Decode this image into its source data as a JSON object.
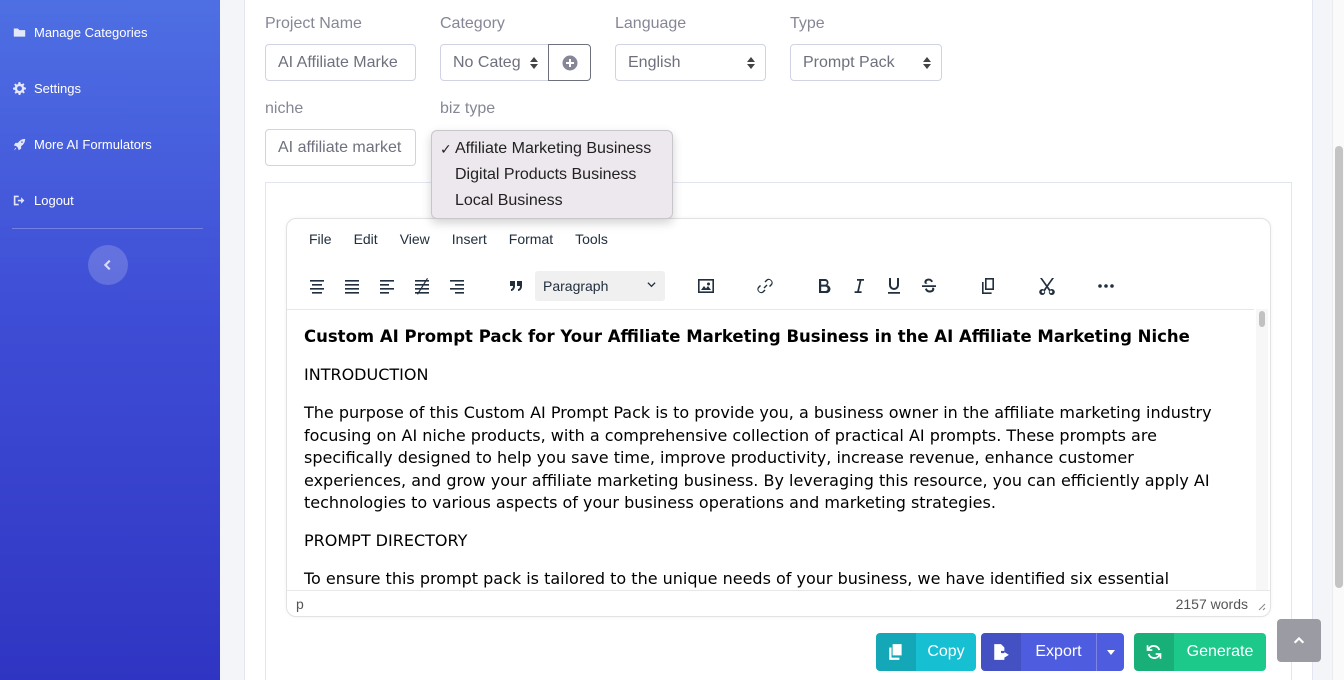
{
  "sidebar": {
    "items": [
      {
        "label": "Manage Categories",
        "icon": "folder-icon"
      },
      {
        "label": "Settings",
        "icon": "gear-icon"
      },
      {
        "label": "More AI Formulators",
        "icon": "rocket-icon"
      },
      {
        "label": "Logout",
        "icon": "sign-out-icon"
      }
    ],
    "collapse_icon": "chevron-left-icon"
  },
  "form": {
    "project_name": {
      "label": "Project Name",
      "value": "AI Affiliate Marke"
    },
    "category": {
      "label": "Category",
      "value": "No Categ",
      "add_icon": "plus-circle-icon"
    },
    "language": {
      "label": "Language",
      "value": "English"
    },
    "type": {
      "label": "Type",
      "value": "Prompt Pack"
    },
    "niche": {
      "label": "niche",
      "value": "AI affiliate market"
    },
    "biz_type": {
      "label": "biz type",
      "options": [
        "Affiliate Marketing Business",
        "Digital Products Business",
        "Local Business"
      ],
      "selected": "Affiliate Marketing Business",
      "check": "✓"
    }
  },
  "editor": {
    "menu": [
      "File",
      "Edit",
      "View",
      "Insert",
      "Format",
      "Tools"
    ],
    "block_format": "Paragraph",
    "content": {
      "heading": "Custom AI Prompt Pack for Your Affiliate Marketing Business in the AI Affiliate Marketing Niche",
      "p1": "INTRODUCTION",
      "p2": "The purpose of this Custom AI Prompt Pack is to provide you, a business owner in the affiliate marketing industry focusing on AI niche products, with a comprehensive collection of practical AI prompts. These prompts are specifically designed to help you save time, improve productivity, increase revenue, enhance customer experiences, and grow your affiliate marketing business. By leveraging this resource, you can efficiently apply AI technologies to various aspects of your business operations and marketing strategies.",
      "p3": "PROMPT DIRECTORY",
      "p4": "To ensure this prompt pack is tailored to the unique needs of your business, we have identified six essential"
    },
    "status_path": "p",
    "word_count": "2157 words"
  },
  "actions": {
    "copy": "Copy",
    "export": "Export",
    "generate": "Generate"
  },
  "colors": {
    "sidebar_top": "#4e6fe3",
    "sidebar_bottom": "#2f35c2",
    "copy": "#17bfd2",
    "export": "#4e5ddf",
    "generate": "#1cc88a"
  }
}
